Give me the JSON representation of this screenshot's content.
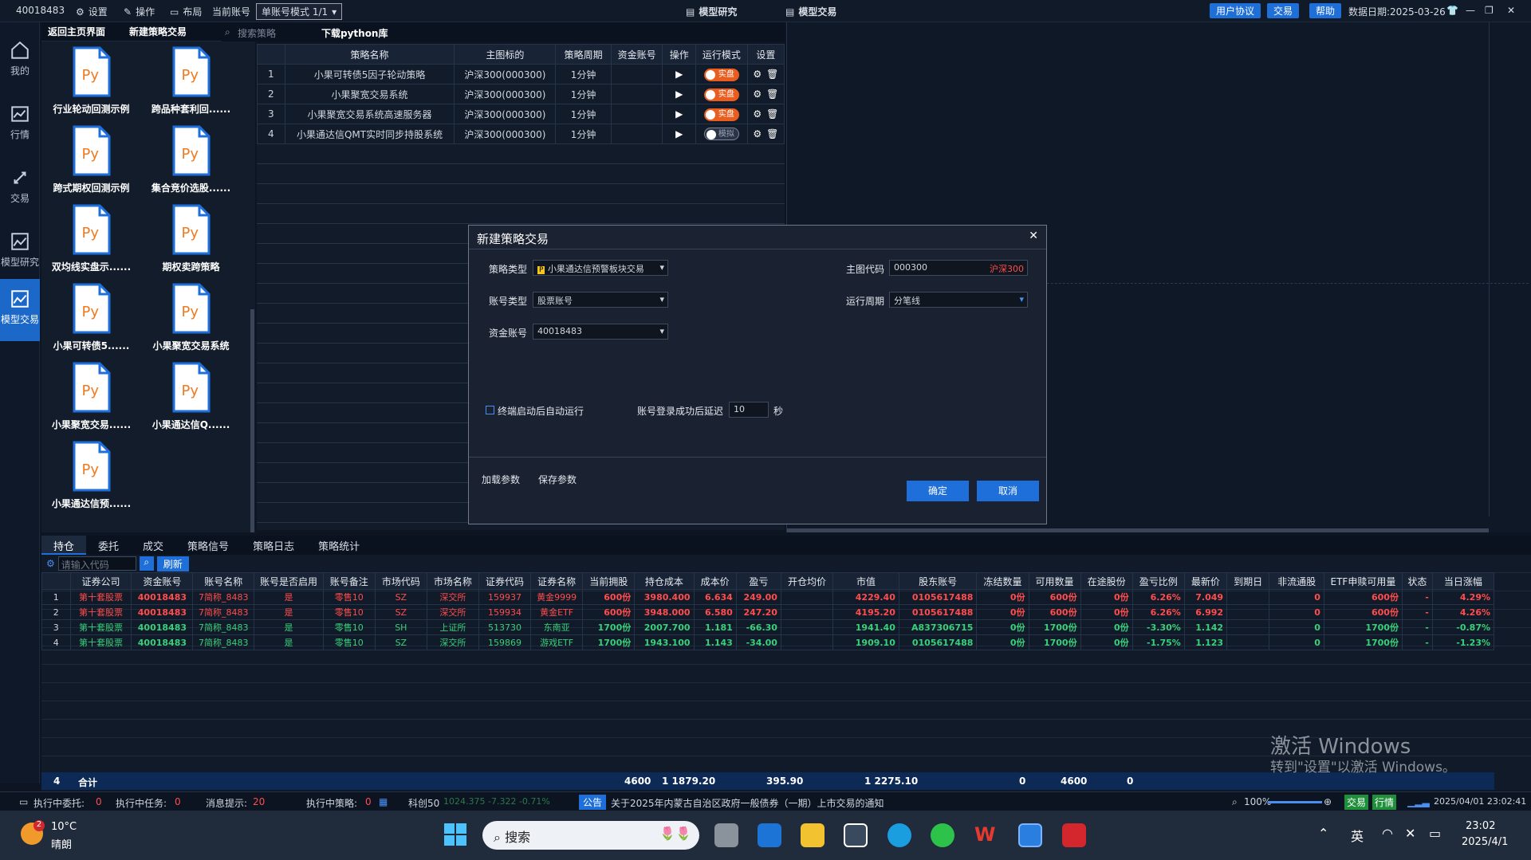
{
  "topbar": {
    "account": "40018483",
    "settings": "设置",
    "operate": "操作",
    "layout": "布局",
    "current_account_label": "当前账号",
    "mode_select": "单账号模式 1/1",
    "model_research": "模型研究",
    "model_trade": "模型交易",
    "user_agreement": "用户协议",
    "trade": "交易",
    "help": "帮助",
    "data_date": "数据日期:2025-03-26"
  },
  "sidebar": [
    {
      "label": "我的",
      "icon": "home-icon"
    },
    {
      "label": "行情",
      "icon": "chart-icon"
    },
    {
      "label": "交易",
      "icon": "trade-icon"
    },
    {
      "label": "模型研究",
      "icon": "research-icon"
    },
    {
      "label": "模型交易",
      "icon": "model-trade-icon"
    }
  ],
  "file_panel": {
    "back": "返回主页界面",
    "new": "新建策略交易",
    "search_placeholder": "搜索策略",
    "download": "下载python库",
    "py_label": "Py",
    "files": [
      "行业轮动回测示例",
      "跨品种套利回......",
      "跨式期权回测示例",
      "集合竞价选股......",
      "双均线实盘示......",
      "期权卖跨策略",
      "小果可转债5......",
      "小果聚宽交易系统",
      "小果聚宽交易......",
      "小果通达信Q......",
      "小果通达信预......"
    ]
  },
  "strategy_table": {
    "headers": [
      "",
      "策略名称",
      "主图标的",
      "策略周期",
      "资金账号",
      "操作",
      "运行模式",
      "设置"
    ],
    "rows": [
      {
        "no": "1",
        "name": "小果可转债5因子轮动策略",
        "target": "沪深300(000300)",
        "period": "1分钟",
        "mode": "实盘",
        "on": true
      },
      {
        "no": "2",
        "name": "小果聚宽交易系统",
        "target": "沪深300(000300)",
        "period": "1分钟",
        "mode": "实盘",
        "on": true
      },
      {
        "no": "3",
        "name": "小果聚宽交易系统高速服务器",
        "target": "沪深300(000300)",
        "period": "1分钟",
        "mode": "实盘",
        "on": true
      },
      {
        "no": "4",
        "name": "小果通达信QMT实时同步持股系统",
        "target": "沪深300(000300)",
        "period": "1分钟",
        "mode": "模拟",
        "on": false
      }
    ]
  },
  "dialog": {
    "title": "新建策略交易",
    "strategy_type_label": "策略类型",
    "strategy_type_value": "小果通达信预警板块交易",
    "main_code_label": "主图代码",
    "main_code_value": "000300",
    "main_code_name": "沪深300",
    "account_type_label": "账号类型",
    "account_type_value": "股票账号",
    "run_period_label": "运行周期",
    "run_period_value": "分笔线",
    "fund_account_label": "资金账号",
    "fund_account_value": "40018483",
    "autorun_label": "终端启动后自动运行",
    "delay_label": "账号登录成功后延迟",
    "delay_value": "10",
    "delay_unit": "秒",
    "load_params": "加载参数",
    "save_params": "保存参数",
    "ok": "确定",
    "cancel": "取消"
  },
  "bottom": {
    "tabs": [
      "持仓",
      "委托",
      "成交",
      "策略信号",
      "策略日志",
      "策略统计"
    ],
    "code_placeholder": "请输入代码",
    "refresh": "刷新",
    "headers": [
      "",
      "证券公司",
      "资金账号",
      "账号名称",
      "账号是否启用",
      "账号备注",
      "市场代码",
      "市场名称",
      "证券代码",
      "证券名称",
      "当前拥股",
      "持仓成本",
      "成本价",
      "盈亏",
      "开仓均价",
      "市值",
      "股东账号",
      "冻结数量",
      "可用数量",
      "在途股份",
      "盈亏比例",
      "最新价",
      "到期日",
      "非流通股",
      "ETF申赎可用量",
      "状态",
      "当日涨幅"
    ],
    "rows": [
      {
        "cells": [
          "1",
          "第十套股票",
          "40018483",
          "7简称_8483",
          "是",
          "零售10",
          "SZ",
          "深交所",
          "159937",
          "黄金9999",
          "600份",
          "3980.400",
          "6.634",
          "249.00",
          "",
          "4229.40",
          "0105617488",
          "0份",
          "600份",
          "0份",
          "6.26%",
          "7.049",
          "",
          "0",
          "600份",
          "-",
          "4.29%"
        ],
        "color": "red"
      },
      {
        "cells": [
          "2",
          "第十套股票",
          "40018483",
          "7简称_8483",
          "是",
          "零售10",
          "SZ",
          "深交所",
          "159934",
          "黄金ETF",
          "600份",
          "3948.000",
          "6.580",
          "247.20",
          "",
          "4195.20",
          "0105617488",
          "0份",
          "600份",
          "0份",
          "6.26%",
          "6.992",
          "",
          "0",
          "600份",
          "-",
          "4.26%"
        ],
        "color": "red"
      },
      {
        "cells": [
          "3",
          "第十套股票",
          "40018483",
          "7简称_8483",
          "是",
          "零售10",
          "SH",
          "上证所",
          "513730",
          "东南亚",
          "1700份",
          "2007.700",
          "1.181",
          "-66.30",
          "",
          "1941.40",
          "A837306715",
          "0份",
          "1700份",
          "0份",
          "-3.30%",
          "1.142",
          "",
          "0",
          "1700份",
          "-",
          "-0.87%"
        ],
        "color": "green"
      },
      {
        "cells": [
          "4",
          "第十套股票",
          "40018483",
          "7简称_8483",
          "是",
          "零售10",
          "SZ",
          "深交所",
          "159869",
          "游戏ETF",
          "1700份",
          "1943.100",
          "1.143",
          "-34.00",
          "",
          "1909.10",
          "0105617488",
          "0份",
          "1700份",
          "0份",
          "-1.75%",
          "1.123",
          "",
          "0",
          "1700份",
          "-",
          "-1.23%"
        ],
        "color": "green"
      }
    ],
    "total": {
      "count": "4",
      "label": "合计",
      "qty": "4600",
      "cost": "1 1879.20",
      "pnl": "395.90",
      "value": "1 2275.10",
      "frozen": "0",
      "avail": "4600",
      "transit": "0"
    }
  },
  "watermark": {
    "line1": "激活 Windows",
    "line2": "转到\"设置\"以激活 Windows。"
  },
  "status": {
    "pending_orders": "执行中委托:",
    "pending_orders_v": "0",
    "pending_tasks": "执行中任务:",
    "pending_tasks_v": "0",
    "msg": "消息提示:",
    "msg_v": "20",
    "running": "执行中策略:",
    "running_v": "0",
    "index_name": "科创50",
    "index_val": "1024.375 -7.322 -0.71%",
    "notice_tag": "公告",
    "notice": "关于2025年内蒙古自治区政府一般债券（一期）上市交易的通知",
    "zoom": "100%",
    "trade_tag": "交易",
    "market_tag": "行情",
    "datetime": "2025/04/01 23:02:41"
  },
  "taskbar": {
    "weather_badge": "2",
    "temp": "10°C",
    "weather": "晴朗",
    "search": "搜索",
    "ime": "英",
    "time": "23:02",
    "date": "2025/4/1"
  }
}
